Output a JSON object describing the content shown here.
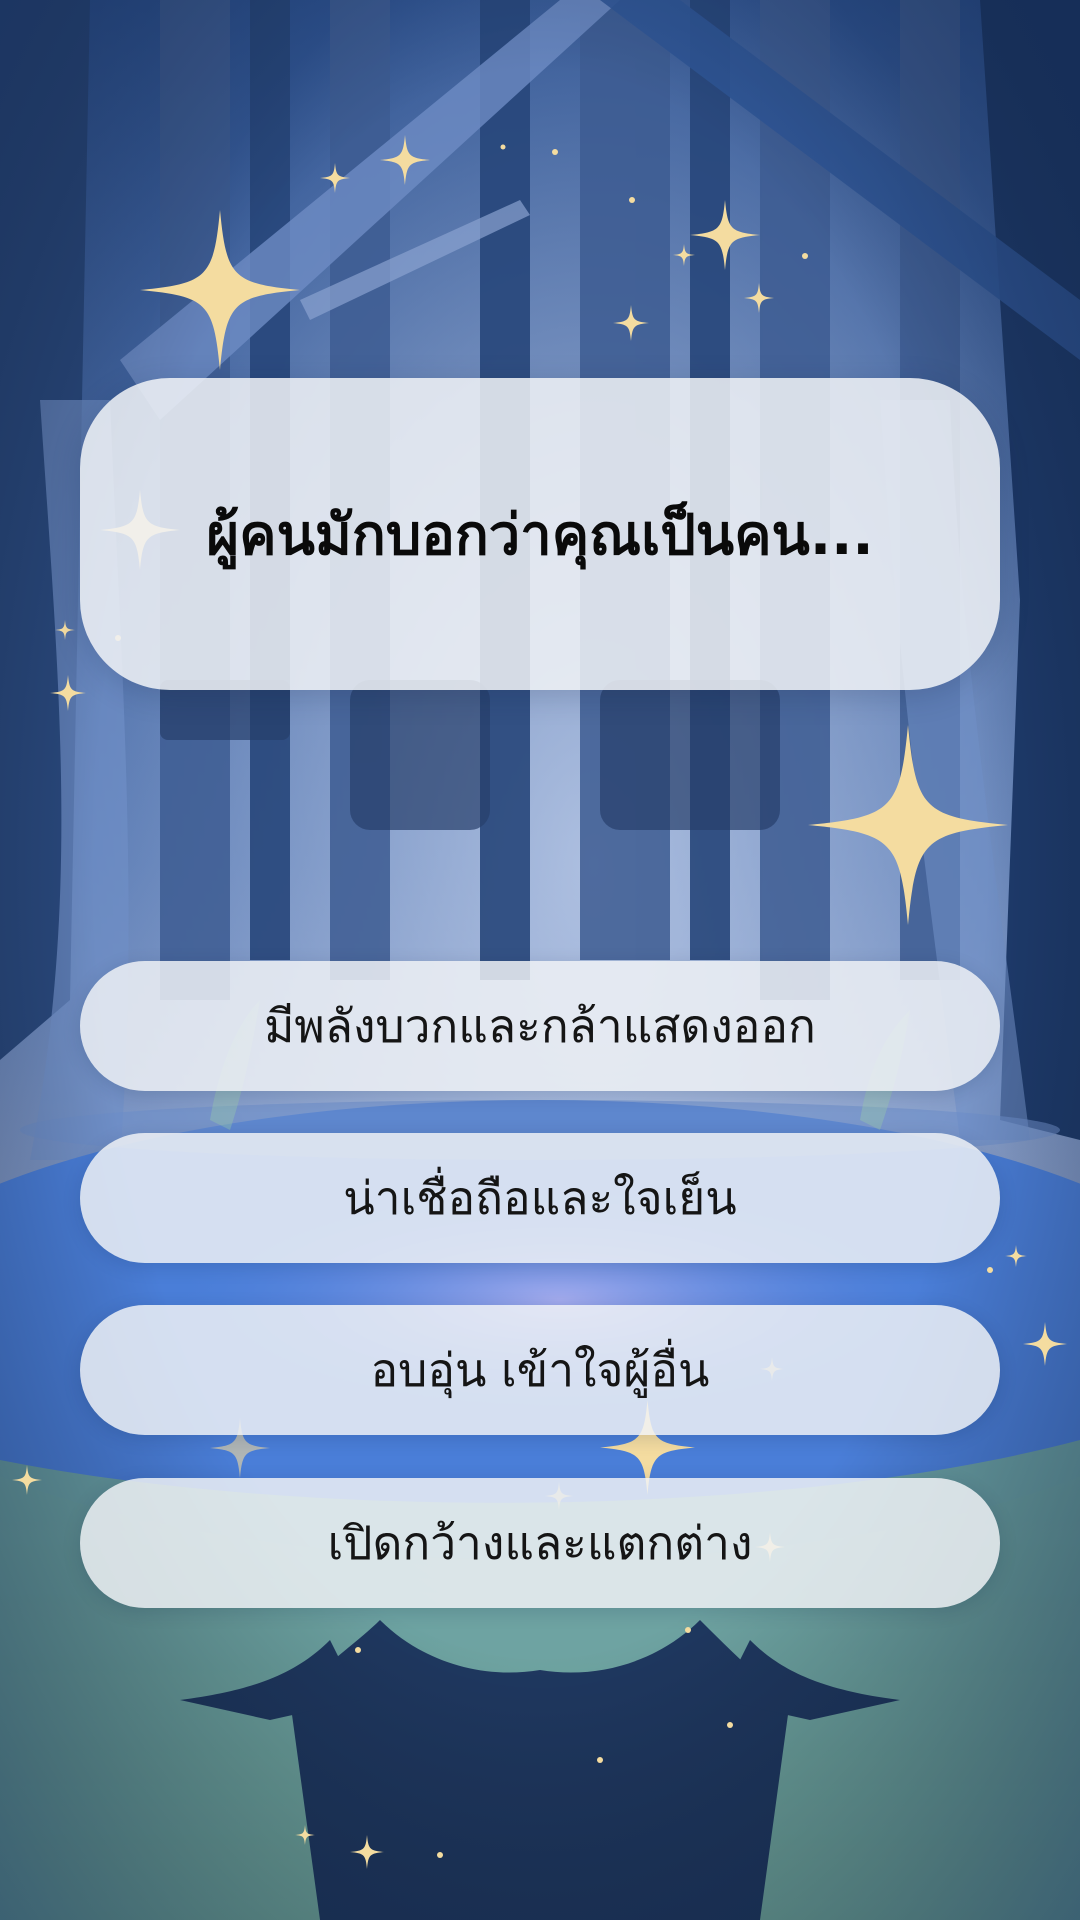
{
  "quiz": {
    "question": "ผู้คนมักบอกว่าคุณเป็นคน...",
    "answers": [
      {
        "label": "มีพลังบวกและกล้าแสดงออก"
      },
      {
        "label": "น่าเชื่อถือและใจเย็น"
      },
      {
        "label": "อบอุ่น เข้าใจผู้อื่น"
      },
      {
        "label": "เปิดกว้างและแตกต่าง"
      }
    ]
  },
  "background": {
    "theme": "enchanted-forest-night",
    "colors": {
      "sky_top": "#2a4f8c",
      "trunk": "#3a5a8e",
      "trunk_dark": "#1e3760",
      "lake": "#4a7fd6",
      "ground": "#7fb8a0",
      "sparkle": "#f4dca0"
    }
  }
}
